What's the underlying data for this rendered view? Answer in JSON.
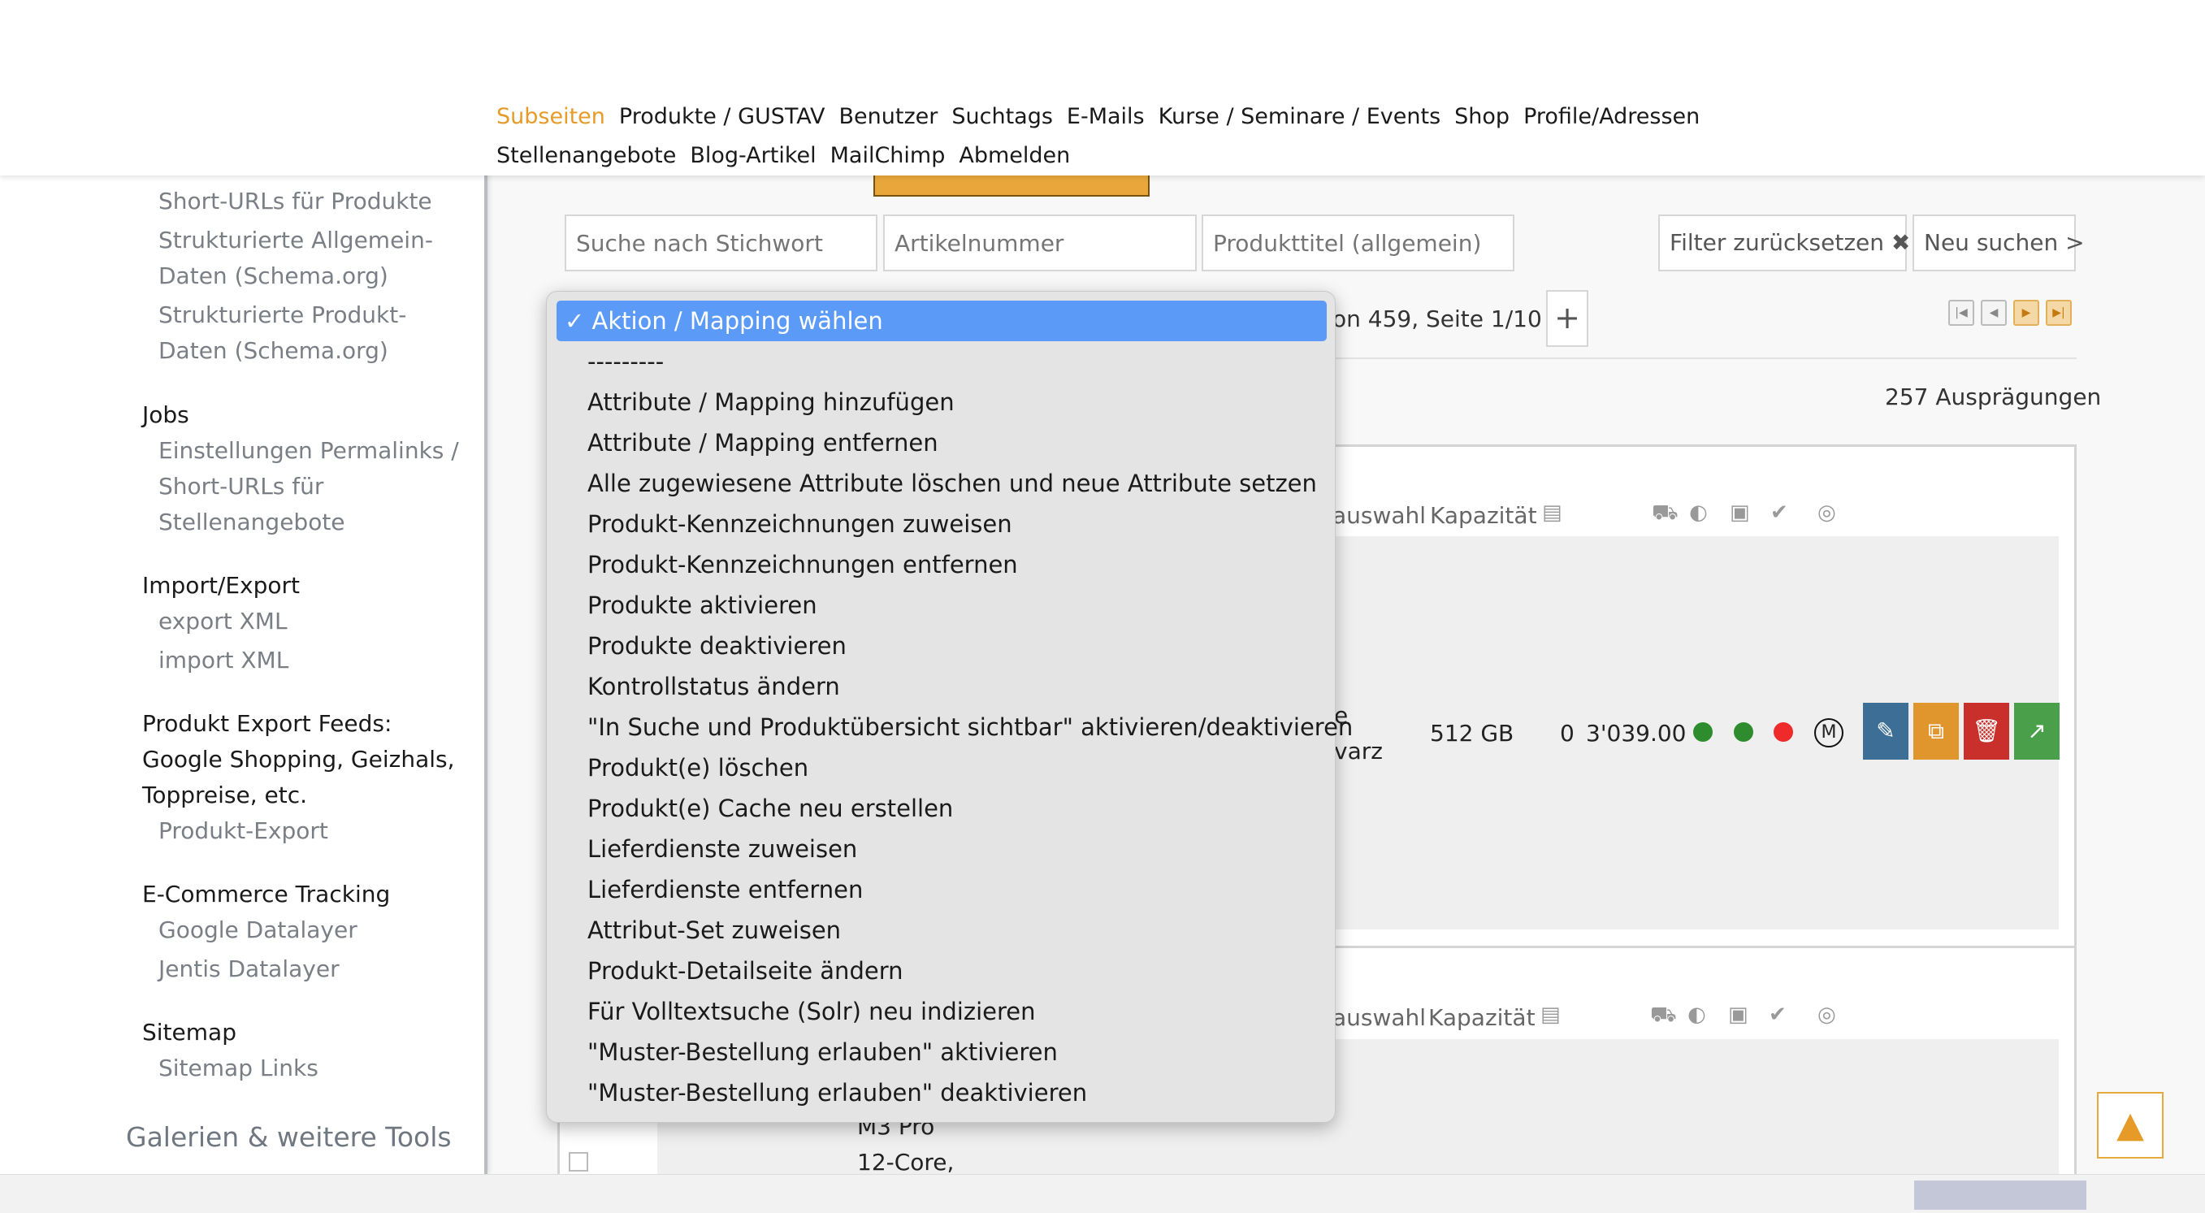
{
  "topnav": {
    "row1": [
      "Subseiten",
      "Produkte / GUSTAV",
      "Benutzer",
      "Suchtags",
      "E-Mails",
      "Kurse / Seminare / Events",
      "Shop",
      "Profile/Adressen"
    ],
    "row2": [
      "Stellenangebote",
      "Blog-Artikel",
      "MailChimp",
      "Abmelden"
    ],
    "active": "Subseiten"
  },
  "sidebar": {
    "link1": "Short-URLs für Produkte",
    "link2": "Strukturierte Allgemein-Daten (Schema.org)",
    "link3": "Strukturierte Produkt-Daten (Schema.org)",
    "jobs_head": "Jobs",
    "jobs_link": "Einstellungen Permalinks / Short-URLs für Stellenangebote",
    "import_head": "Import/Export",
    "export_link": "export XML",
    "import_link": "import XML",
    "feeds_head": "Produkt Export Feeds: Google Shopping, Geizhals, Toppreise, etc.",
    "feeds_link": "Produkt-Export",
    "tracking_head": "E-Commerce Tracking",
    "google_link": "Google Datalayer",
    "jentis_link": "Jentis Datalayer",
    "sitemap_head": "Sitemap",
    "sitemap_link": "Sitemap Links",
    "section_title": "Galerien & weitere Tools"
  },
  "search": {
    "keyword_placeholder": "Suche nach Stichwort",
    "article_placeholder": "Artikelnummer",
    "title_placeholder": "Produkttitel (allgemein)",
    "reset_label": "Filter zurücksetzen ✖",
    "search_label": "Neu suchen >"
  },
  "pager": {
    "text": "on 459, Seite 1/10",
    "add_label": "+",
    "count_text": "257 Ausprägungen"
  },
  "dropdown": {
    "options": [
      "✓ Aktion / Mapping wählen",
      "---------",
      "Attribute / Mapping hinzufügen",
      "Attribute / Mapping entfernen",
      "Alle zugewiesene Attribute löschen und neue Attribute setzen",
      "Produkt-Kennzeichnungen zuweisen",
      "Produkt-Kennzeichnungen entfernen",
      "Produkte aktivieren",
      "Produkte deaktivieren",
      "Kontrollstatus ändern",
      "\"In Suche und Produktübersicht sichtbar\" aktivieren/deaktivieren",
      "Produkt(e) löschen",
      "Produkt(e) Cache neu erstellen",
      "Lieferdienste zuweisen",
      "Lieferdienste entfernen",
      "Attribut-Set zuweisen",
      "Produkt-Detailseite ändern",
      "Für Volltextsuche (Solr) neu indizieren",
      "\"Muster-Bestellung erlauben\" aktivieren",
      "\"Muster-Bestellung erlauben\" deaktivieren"
    ]
  },
  "product1": {
    "hdr_auswahl": "auswahl",
    "hdr_kapazitaet": "Kapazität",
    "variant_line1": "e",
    "variant_line2": "varz",
    "capacity": "512 GB",
    "stock": "0",
    "price": "3'039.00",
    "dot_colors": [
      "#2e8b2e",
      "#2e8b2e",
      "#ee2a2a"
    ]
  },
  "product2": {
    "hdr_auswahl": "auswahl",
    "hdr_kapazitaet": "Kapazität",
    "desc_line1": "M3 Pro",
    "desc_line2": "12-Core,"
  },
  "colors": {
    "accent": "#e69a27",
    "selected_option": "#5b9bf7",
    "edit": "#3d6f96",
    "copy": "#e0962d",
    "delete": "#c9302c",
    "open": "#4aa04a"
  }
}
